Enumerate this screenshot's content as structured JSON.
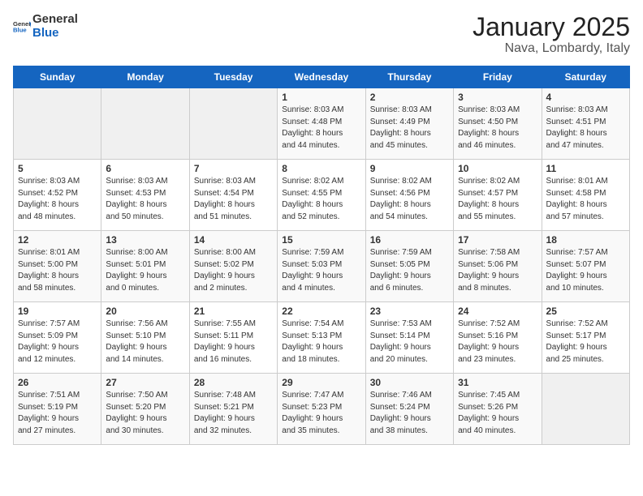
{
  "logo": {
    "general": "General",
    "blue": "Blue"
  },
  "title": "January 2025",
  "subtitle": "Nava, Lombardy, Italy",
  "weekdays": [
    "Sunday",
    "Monday",
    "Tuesday",
    "Wednesday",
    "Thursday",
    "Friday",
    "Saturday"
  ],
  "weeks": [
    [
      {
        "day": "",
        "info": ""
      },
      {
        "day": "",
        "info": ""
      },
      {
        "day": "",
        "info": ""
      },
      {
        "day": "1",
        "info": "Sunrise: 8:03 AM\nSunset: 4:48 PM\nDaylight: 8 hours\nand 44 minutes."
      },
      {
        "day": "2",
        "info": "Sunrise: 8:03 AM\nSunset: 4:49 PM\nDaylight: 8 hours\nand 45 minutes."
      },
      {
        "day": "3",
        "info": "Sunrise: 8:03 AM\nSunset: 4:50 PM\nDaylight: 8 hours\nand 46 minutes."
      },
      {
        "day": "4",
        "info": "Sunrise: 8:03 AM\nSunset: 4:51 PM\nDaylight: 8 hours\nand 47 minutes."
      }
    ],
    [
      {
        "day": "5",
        "info": "Sunrise: 8:03 AM\nSunset: 4:52 PM\nDaylight: 8 hours\nand 48 minutes."
      },
      {
        "day": "6",
        "info": "Sunrise: 8:03 AM\nSunset: 4:53 PM\nDaylight: 8 hours\nand 50 minutes."
      },
      {
        "day": "7",
        "info": "Sunrise: 8:03 AM\nSunset: 4:54 PM\nDaylight: 8 hours\nand 51 minutes."
      },
      {
        "day": "8",
        "info": "Sunrise: 8:02 AM\nSunset: 4:55 PM\nDaylight: 8 hours\nand 52 minutes."
      },
      {
        "day": "9",
        "info": "Sunrise: 8:02 AM\nSunset: 4:56 PM\nDaylight: 8 hours\nand 54 minutes."
      },
      {
        "day": "10",
        "info": "Sunrise: 8:02 AM\nSunset: 4:57 PM\nDaylight: 8 hours\nand 55 minutes."
      },
      {
        "day": "11",
        "info": "Sunrise: 8:01 AM\nSunset: 4:58 PM\nDaylight: 8 hours\nand 57 minutes."
      }
    ],
    [
      {
        "day": "12",
        "info": "Sunrise: 8:01 AM\nSunset: 5:00 PM\nDaylight: 8 hours\nand 58 minutes."
      },
      {
        "day": "13",
        "info": "Sunrise: 8:00 AM\nSunset: 5:01 PM\nDaylight: 9 hours\nand 0 minutes."
      },
      {
        "day": "14",
        "info": "Sunrise: 8:00 AM\nSunset: 5:02 PM\nDaylight: 9 hours\nand 2 minutes."
      },
      {
        "day": "15",
        "info": "Sunrise: 7:59 AM\nSunset: 5:03 PM\nDaylight: 9 hours\nand 4 minutes."
      },
      {
        "day": "16",
        "info": "Sunrise: 7:59 AM\nSunset: 5:05 PM\nDaylight: 9 hours\nand 6 minutes."
      },
      {
        "day": "17",
        "info": "Sunrise: 7:58 AM\nSunset: 5:06 PM\nDaylight: 9 hours\nand 8 minutes."
      },
      {
        "day": "18",
        "info": "Sunrise: 7:57 AM\nSunset: 5:07 PM\nDaylight: 9 hours\nand 10 minutes."
      }
    ],
    [
      {
        "day": "19",
        "info": "Sunrise: 7:57 AM\nSunset: 5:09 PM\nDaylight: 9 hours\nand 12 minutes."
      },
      {
        "day": "20",
        "info": "Sunrise: 7:56 AM\nSunset: 5:10 PM\nDaylight: 9 hours\nand 14 minutes."
      },
      {
        "day": "21",
        "info": "Sunrise: 7:55 AM\nSunset: 5:11 PM\nDaylight: 9 hours\nand 16 minutes."
      },
      {
        "day": "22",
        "info": "Sunrise: 7:54 AM\nSunset: 5:13 PM\nDaylight: 9 hours\nand 18 minutes."
      },
      {
        "day": "23",
        "info": "Sunrise: 7:53 AM\nSunset: 5:14 PM\nDaylight: 9 hours\nand 20 minutes."
      },
      {
        "day": "24",
        "info": "Sunrise: 7:52 AM\nSunset: 5:16 PM\nDaylight: 9 hours\nand 23 minutes."
      },
      {
        "day": "25",
        "info": "Sunrise: 7:52 AM\nSunset: 5:17 PM\nDaylight: 9 hours\nand 25 minutes."
      }
    ],
    [
      {
        "day": "26",
        "info": "Sunrise: 7:51 AM\nSunset: 5:19 PM\nDaylight: 9 hours\nand 27 minutes."
      },
      {
        "day": "27",
        "info": "Sunrise: 7:50 AM\nSunset: 5:20 PM\nDaylight: 9 hours\nand 30 minutes."
      },
      {
        "day": "28",
        "info": "Sunrise: 7:48 AM\nSunset: 5:21 PM\nDaylight: 9 hours\nand 32 minutes."
      },
      {
        "day": "29",
        "info": "Sunrise: 7:47 AM\nSunset: 5:23 PM\nDaylight: 9 hours\nand 35 minutes."
      },
      {
        "day": "30",
        "info": "Sunrise: 7:46 AM\nSunset: 5:24 PM\nDaylight: 9 hours\nand 38 minutes."
      },
      {
        "day": "31",
        "info": "Sunrise: 7:45 AM\nSunset: 5:26 PM\nDaylight: 9 hours\nand 40 minutes."
      },
      {
        "day": "",
        "info": ""
      }
    ]
  ]
}
